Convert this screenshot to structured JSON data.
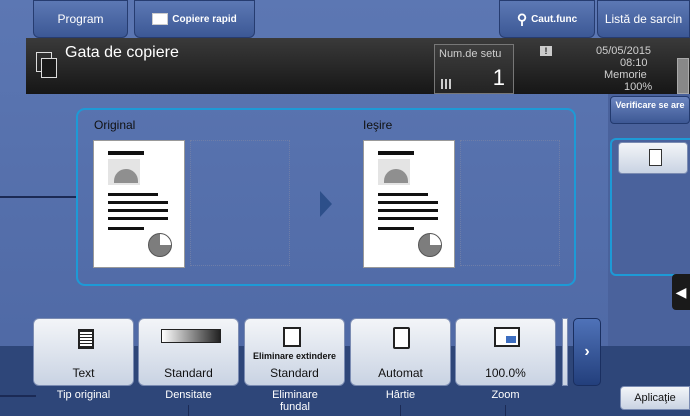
{
  "top": {
    "program_label": "Program",
    "quick_copy_label": "Copiere rapid",
    "search_label": "Caut.func",
    "job_list_label": "Listă de sarcin"
  },
  "header": {
    "title": "Gata de copiere",
    "sets_label": "Num.de setu",
    "sets_value": "1",
    "date": "05/05/2015",
    "time": "08:10",
    "memory_label": "Memorie",
    "memory_value": "100%"
  },
  "preview": {
    "original_label": "Original",
    "output_label": "Ieşire"
  },
  "right": {
    "verify_label": "Verificare se are"
  },
  "functions": [
    {
      "label": "Text",
      "caption": "Tip original"
    },
    {
      "label": "Standard",
      "caption": "Densitate"
    },
    {
      "label_top": "Eliminare extindere",
      "label": "Standard",
      "caption": "Eliminare fundal"
    },
    {
      "label": "Automat",
      "caption": "Hârtie"
    },
    {
      "label": "100.0%",
      "caption": "Zoom"
    }
  ],
  "bottom": {
    "app_label": "Aplicaţie"
  }
}
